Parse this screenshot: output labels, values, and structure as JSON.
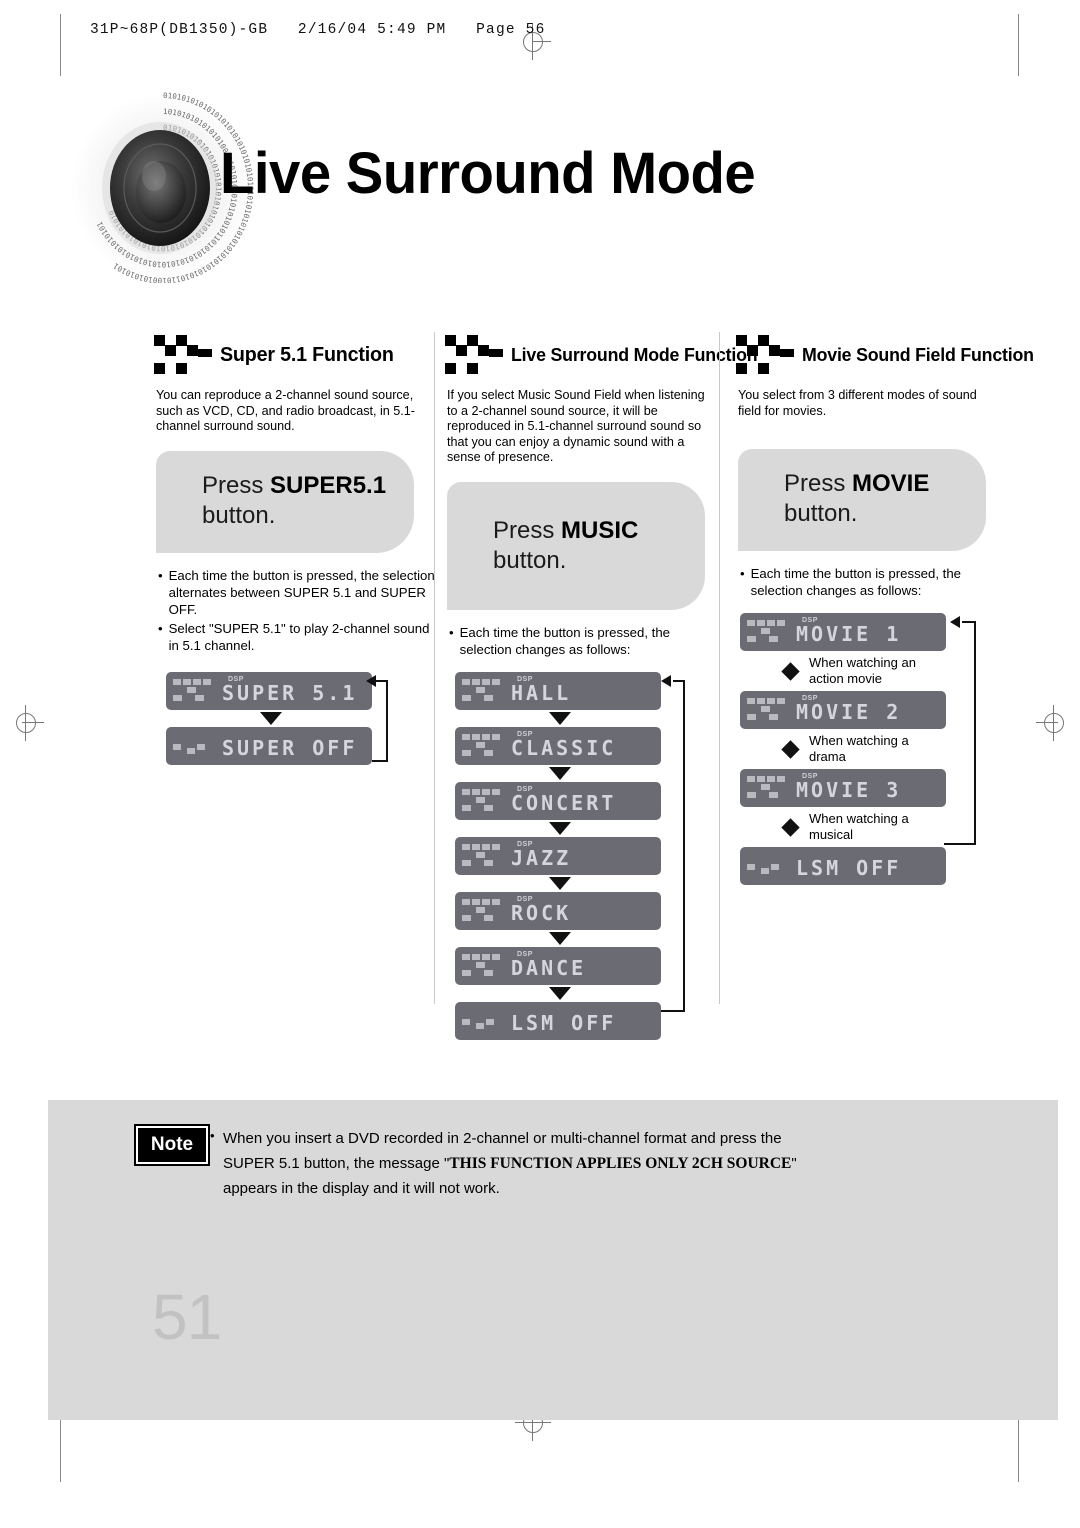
{
  "file_header": "31P~68P(DB1350)-GB   2/16/04 5:49 PM   Page 56",
  "page_title": "Live Surround Mode",
  "page_number": "51",
  "columns": [
    {
      "icon": "checkered-chevron-icon",
      "title": "Super 5.1 Function",
      "description": "You can reproduce a 2-channel sound source, such as VCD, CD, and radio broadcast, in 5.1-channel surround sound.",
      "press_prefix": "Press ",
      "press_bold": "SUPER5.1",
      "press_suffix": " button.",
      "bullets": [
        "Each time the button is pressed, the selection alternates between SUPER 5.1 and SUPER OFF.",
        "Select \"SUPER 5.1\" to play 2-channel sound in 5.1 channel."
      ],
      "displays": [
        {
          "dsp": "DSP",
          "value": "SUPER 5.1",
          "icons": "full"
        },
        {
          "dsp": "",
          "value": "SUPER OFF",
          "icons": "min"
        }
      ],
      "annotations": []
    },
    {
      "icon": "checkered-chevron-icon",
      "title": "Live Surround Mode Function",
      "description": "If you select Music Sound Field when listening to a 2-channel sound source, it will be reproduced in 5.1-channel surround sound so that you can enjoy a dynamic sound with a sense of presence.",
      "press_prefix": "Press ",
      "press_bold": "MUSIC",
      "press_suffix": " button.",
      "bullets": [
        "Each time the button is pressed, the selection changes as follows:"
      ],
      "displays": [
        {
          "dsp": "DSP",
          "value": "HALL",
          "icons": "full"
        },
        {
          "dsp": "DSP",
          "value": "CLASSIC",
          "icons": "full"
        },
        {
          "dsp": "DSP",
          "value": "CONCERT",
          "icons": "full"
        },
        {
          "dsp": "DSP",
          "value": "JAZZ",
          "icons": "full"
        },
        {
          "dsp": "DSP",
          "value": "ROCK",
          "icons": "full"
        },
        {
          "dsp": "DSP",
          "value": "DANCE",
          "icons": "full"
        },
        {
          "dsp": "",
          "value": "LSM OFF",
          "icons": "min"
        }
      ],
      "annotations": []
    },
    {
      "icon": "checkered-chevron-icon",
      "title": "Movie Sound Field Function",
      "description": "You select from 3 different modes of sound field for movies.",
      "press_prefix": "Press ",
      "press_bold": "MOVIE",
      "press_suffix": " button.",
      "bullets": [
        "Each time the button is pressed, the selection changes as follows:"
      ],
      "displays": [
        {
          "dsp": "DSP",
          "value": "MOVIE 1",
          "icons": "full"
        },
        {
          "dsp": "DSP",
          "value": "MOVIE 2",
          "icons": "full"
        },
        {
          "dsp": "DSP",
          "value": "MOVIE 3",
          "icons": "full"
        },
        {
          "dsp": "",
          "value": "LSM OFF",
          "icons": "min"
        }
      ],
      "annotations": [
        "When watching an action movie",
        "When watching a drama",
        "When watching a musical"
      ]
    }
  ],
  "note": {
    "badge": "Note",
    "bullet": "•",
    "line1": "When you insert a DVD recorded in 2-channel or multi-channel format and press the",
    "line2_a": "SUPER 5.1 button, the message \"",
    "line2_bold": "THIS FUNCTION APPLIES ONLY 2CH SOURCE",
    "line2_b": "\"",
    "line3": "appears in the display and it will not work."
  },
  "colors": {
    "lcd_background": "#6b6b73",
    "lcd_text": "#d5d5db",
    "panel_gray": "#d9d9d9",
    "page_number": "#c2c2c2"
  }
}
